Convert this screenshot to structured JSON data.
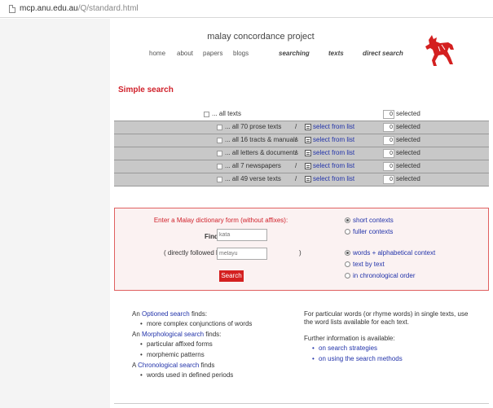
{
  "browser": {
    "url_host": "mcp.anu.edu.au",
    "url_path": "/Q/standard.html"
  },
  "header": {
    "title": "malay concordance project",
    "nav": [
      {
        "label": "home",
        "style": "plain"
      },
      {
        "label": "about",
        "style": "plain"
      },
      {
        "label": "papers",
        "style": "plain"
      },
      {
        "label": "blogs",
        "style": "plain"
      },
      {
        "label": "searching",
        "style": "emphasis"
      },
      {
        "label": "texts",
        "style": "emphasis"
      },
      {
        "label": "direct search",
        "style": "emphasis"
      }
    ],
    "logo_icon": "red-horse-logo",
    "colors": {
      "accent": "#d0202a",
      "link": "#2233aa"
    }
  },
  "section_title": "Simple search",
  "texts": {
    "all_label": "... all texts",
    "all_count": "0",
    "selected_label": "selected",
    "select_link": "select from list",
    "slash": "/",
    "rows": [
      {
        "label": "... all 70 prose texts",
        "count": "0"
      },
      {
        "label": "... all 16 tracts & manuals",
        "count": "0"
      },
      {
        "label": "... all letters & documents",
        "count": "0"
      },
      {
        "label": "... all 7 newspapers",
        "count": "0"
      },
      {
        "label": "... all 49 verse texts",
        "count": "0"
      }
    ]
  },
  "search": {
    "prompt": "Enter a Malay dictionary form (without affixes):",
    "find_label": "Find:",
    "find_placeholder": "kata",
    "followed_label": "( directly followed by",
    "followed_placeholder": "melayu",
    "close_paren": ")",
    "button_label": "Search",
    "context_options": [
      {
        "label": "short contexts",
        "checked": true
      },
      {
        "label": "fuller contexts",
        "checked": false
      }
    ],
    "order_options": [
      {
        "label": "words + alphabetical context",
        "checked": true
      },
      {
        "label": "text by text",
        "checked": false
      },
      {
        "label": "in chronological order",
        "checked": false
      }
    ]
  },
  "info_left": {
    "optioned_pre": "An ",
    "optioned_link": "Optioned search",
    "optioned_post": " finds:",
    "optioned_items": [
      "more complex conjunctions of words"
    ],
    "morph_pre": "An ",
    "morph_link": "Morphological search",
    "morph_post": " finds:",
    "morph_items": [
      "particular affixed forms",
      "morphemic patterns"
    ],
    "chrono_pre": "A ",
    "chrono_link": "Chronological search",
    "chrono_post": " finds",
    "chrono_items": [
      "words used in defined periods"
    ]
  },
  "info_right": {
    "para": "For particular words (or rhyme words) in single texts, use the word lists available for each text.",
    "further": "Further information is available:",
    "links": [
      "on search strategies",
      "on using the search methods"
    ]
  }
}
